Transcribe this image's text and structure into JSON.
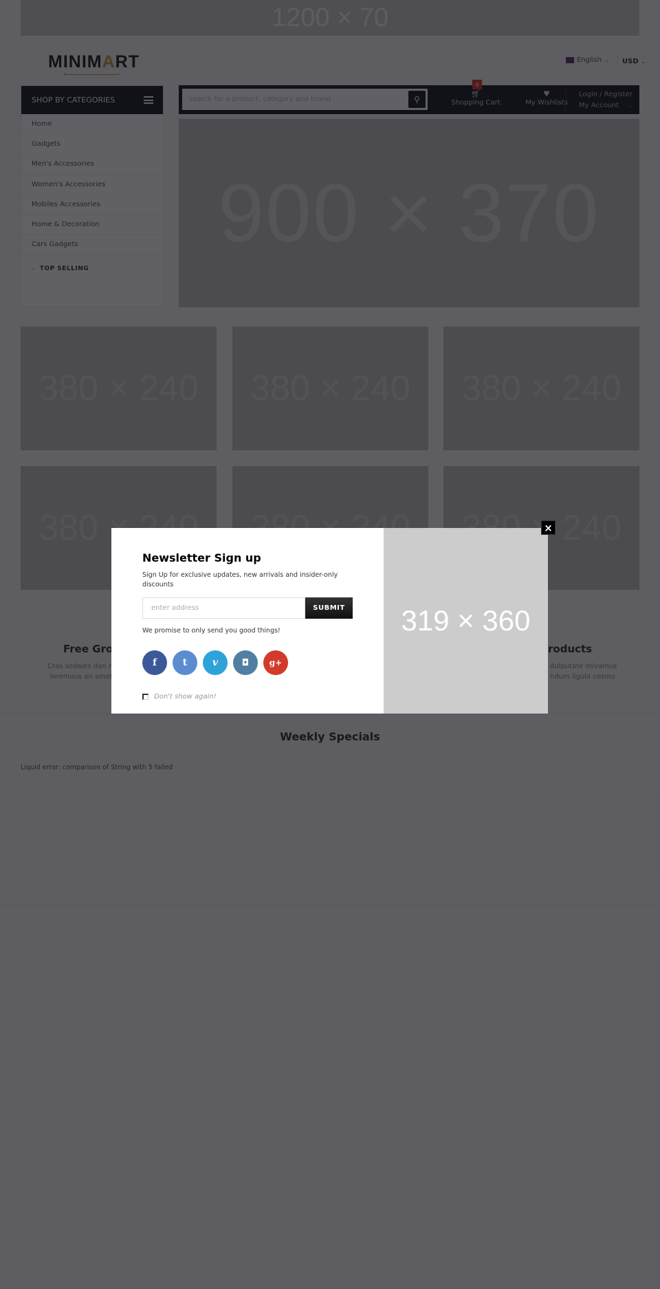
{
  "top_banner": {
    "label": "1200 × 70"
  },
  "logo": {
    "prefix": "MINIM",
    "accent": "A",
    "suffix": "RT"
  },
  "header": {
    "language": "English",
    "currency": "USD"
  },
  "sidebar": {
    "title": "SHOP BY CATEGORIES",
    "items": [
      {
        "label": "Home"
      },
      {
        "label": "Gadgets"
      },
      {
        "label": "Men's Accessories"
      },
      {
        "label": "Women's Accessories"
      },
      {
        "label": "Mobiles Accessories"
      },
      {
        "label": "Home & Decoration"
      },
      {
        "label": "Cars Gadgets"
      }
    ],
    "top_selling": "TOP SELLING"
  },
  "navbar": {
    "search_placeholder": "search for a product, category and brand",
    "cart_label": "Shopping Cart",
    "cart_count": "0",
    "wishlist_label": "My Wishlists",
    "login_label": "Login / Register",
    "account_label": "My Account"
  },
  "hero": {
    "label": "900 × 370"
  },
  "banners": [
    {
      "label": "380 × 240"
    },
    {
      "label": "380 × 240"
    },
    {
      "label": "380 × 240"
    },
    {
      "label": "380 × 240"
    },
    {
      "label": "380 × 240"
    },
    {
      "label": "380 × 240"
    }
  ],
  "features": {
    "left_title": "Free Grou",
    "left_desc_1": "Cras sodales dan m",
    "left_desc_2": "loremous an amet",
    "right_title": "roducts",
    "right_desc_1": "dulputate mivamus",
    "right_desc_2": "ndum ligula cosmo"
  },
  "weekly": {
    "title": "Weekly Specials",
    "error": "Liquid error: comparison of String with 5 failed"
  },
  "newsletter": {
    "title": "Newsletter Sign up",
    "subtitle": "Sign Up for exclusive updates, new arrivals and insider-only discounts",
    "input_placeholder": "enter address",
    "submit_label": "SUBMIT",
    "promise": "We promise to only send you good things!",
    "dont_show": "Don't show again!",
    "image_label": "319 × 360",
    "close_label": "×",
    "socials": [
      {
        "name": "facebook",
        "glyph": "f",
        "color": "#3b5998"
      },
      {
        "name": "twitter",
        "glyph": "t",
        "color": "#5b8ccf"
      },
      {
        "name": "vimeo",
        "glyph": "v",
        "color": "#2ea3da"
      },
      {
        "name": "instagram",
        "glyph": "◘",
        "color": "#517fa4"
      },
      {
        "name": "google-plus",
        "glyph": "g+",
        "color": "#d23a2c"
      }
    ]
  }
}
